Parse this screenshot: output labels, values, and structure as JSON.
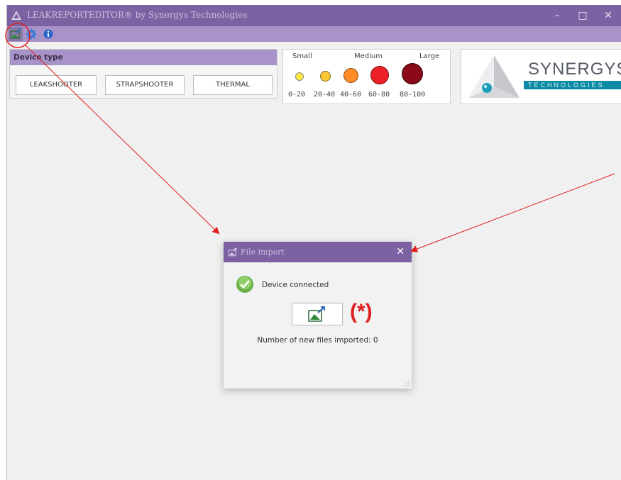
{
  "window": {
    "title": "LEAKREPORTEDITOR® by Synergys Technologies",
    "controls": {
      "minimize": "–",
      "maximize": "□",
      "close": "✕"
    }
  },
  "toolbar": {
    "icons": [
      "file-import-icon",
      "gear-icon",
      "info-icon"
    ]
  },
  "device_panel": {
    "heading": "Device type",
    "buttons": [
      "LEAKSHOOTER",
      "STRAPSHOOTER",
      "THERMAL"
    ]
  },
  "legend": {
    "size_labels": [
      "Small",
      "Medium",
      "Large"
    ],
    "ranges": [
      "0-20",
      "20-40",
      "40-60",
      "60-80",
      "80-100"
    ],
    "colors": [
      "#ffe940",
      "#ffc832",
      "#ff8c26",
      "#ec2028",
      "#8b0a1a"
    ]
  },
  "brand": {
    "name": "SYNERGYS",
    "tagline": "TECHNOLOGIES"
  },
  "dialog": {
    "title": "File import",
    "close_label": "✕",
    "status": "Device connected",
    "files_imported": "Number of new files imported: 0"
  },
  "annotation": {
    "marker": "(*)",
    "color": "#e02020"
  },
  "colors": {
    "titlebar": "#7d62a3",
    "toolbar": "#a893c8",
    "brand_teal": "#0a8aa4"
  }
}
